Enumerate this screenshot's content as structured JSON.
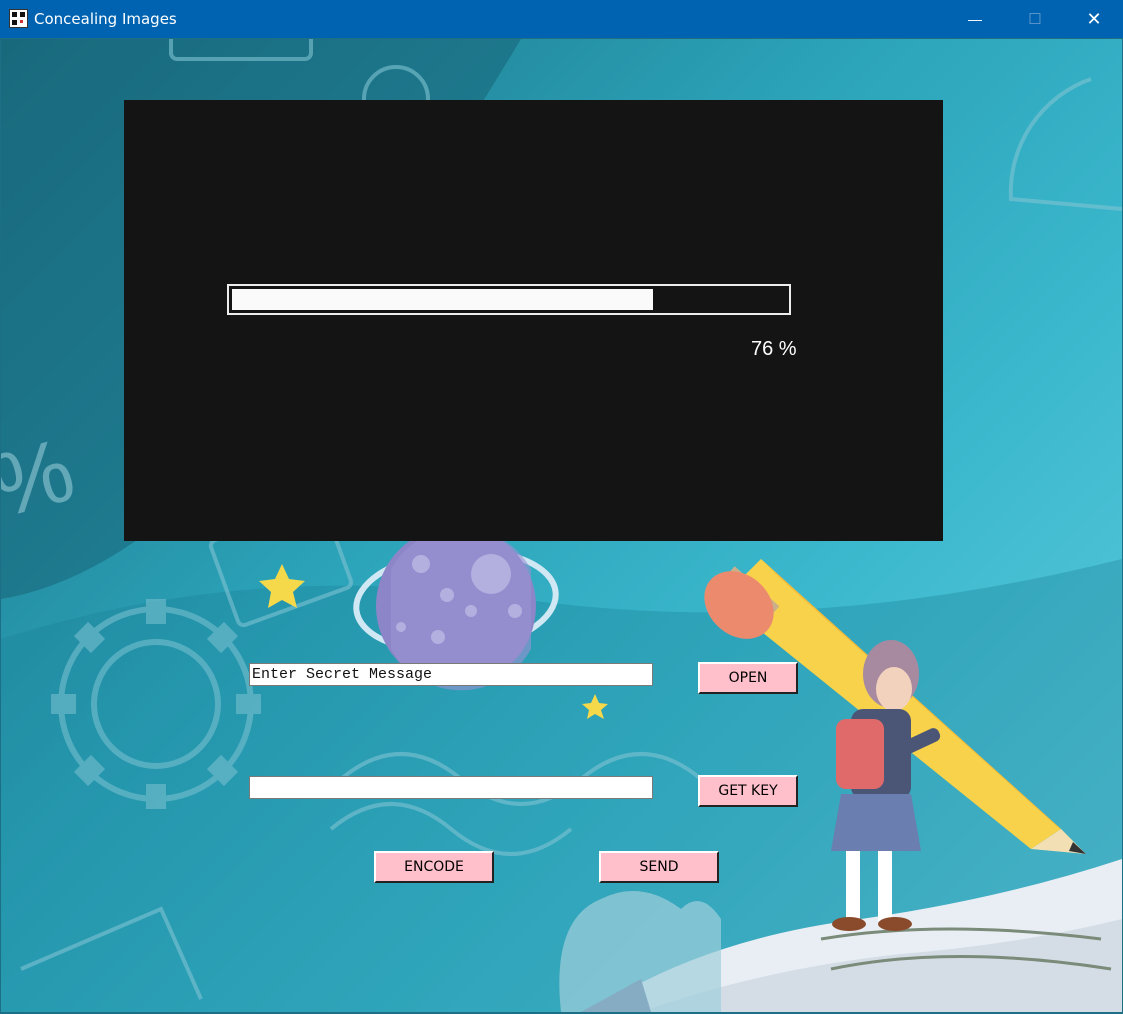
{
  "window": {
    "title": "Concealing Images",
    "controls": {
      "minimize": "—",
      "maximize": "☐",
      "close": "✕"
    }
  },
  "progress": {
    "value": 0.76,
    "percent_label": "76 %"
  },
  "form": {
    "message_input": {
      "value": "Enter Secret Message"
    },
    "key_input": {
      "value": ""
    }
  },
  "buttons": {
    "open": "OPEN",
    "get_key": "GET KEY",
    "encode": "ENCODE",
    "send": "SEND"
  },
  "background": {
    "decor_text": "%"
  },
  "colors": {
    "titlebar": "#0063b1",
    "panel": "#141414",
    "button": "#ffc0cb",
    "progress_fill": "#fafafa"
  }
}
